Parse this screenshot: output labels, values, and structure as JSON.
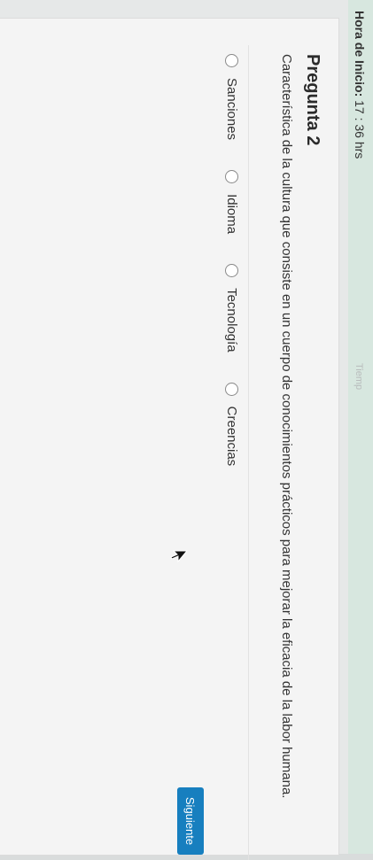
{
  "header": {
    "start_label": "Hora de Inicio:",
    "start_time": "17 : 36 hrs",
    "timer_ghost": "Tiemp"
  },
  "question": {
    "title": "Pregunta 2",
    "text": "Característica de la cultura que consiste en un cuerpo de conocimientos prácticos para mejorar la eficacia de la labor humana."
  },
  "options": [
    "Sanciones",
    "Idioma",
    "Tecnología",
    "Creencias"
  ],
  "next_button": "Siguiente",
  "colors": {
    "accent": "#177fbf",
    "header_bg": "#d7e7df"
  }
}
